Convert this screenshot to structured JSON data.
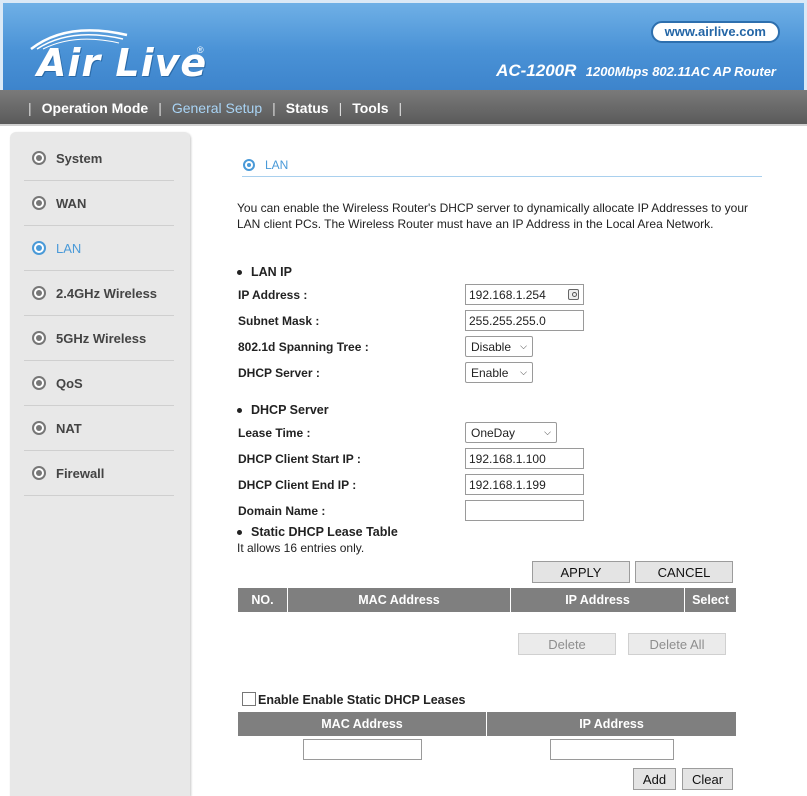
{
  "header": {
    "brand": "Air Live",
    "reg_mark": "®",
    "url": "www.airlive.com",
    "model": "AC-1200R",
    "model_desc": "1200Mbps 802.11AC AP Router"
  },
  "nav": {
    "items": [
      "Operation Mode",
      "General Setup",
      "Status",
      "Tools"
    ],
    "active": "General Setup"
  },
  "sidebar": {
    "items": [
      "System",
      "WAN",
      "LAN",
      "2.4GHz Wireless",
      "5GHz Wireless",
      "QoS",
      "NAT",
      "Firewall"
    ],
    "active": "LAN"
  },
  "main": {
    "title": "LAN",
    "description": "You can enable the Wireless Router's DHCP server to dynamically allocate IP Addresses to your LAN client PCs. The Wireless Router must have an IP Address in the Local Area Network.",
    "lan_ip": {
      "heading": "LAN IP",
      "ip_label": "IP Address :",
      "ip_value": "192.168.1.254",
      "mask_label": "Subnet Mask :",
      "mask_value": "255.255.255.0",
      "stp_label": "802.1d Spanning Tree :",
      "stp_value": "Disable",
      "dhcp_label": "DHCP Server :",
      "dhcp_value": "Enable"
    },
    "dhcp_server": {
      "heading": "DHCP Server",
      "lease_label": "Lease Time :",
      "lease_value": "OneDay",
      "start_label": "DHCP Client Start IP :",
      "start_value": "192.168.1.100",
      "end_label": "DHCP Client End IP :",
      "end_value": "192.168.1.199",
      "domain_label": "Domain Name :",
      "domain_value": ""
    },
    "static_table": {
      "heading": "Static DHCP Lease Table",
      "note": "It allows 16 entries only.",
      "apply": "APPLY",
      "cancel": "CANCEL",
      "columns": [
        "NO.",
        "MAC Address",
        "IP Address",
        "Select"
      ],
      "delete": "Delete",
      "delete_all": "Delete All"
    },
    "static_form": {
      "enable_label": "Enable Enable Static DHCP Leases",
      "enabled": false,
      "columns": [
        "MAC Address",
        "IP Address"
      ],
      "mac_value": "",
      "ip_value": "",
      "add": "Add",
      "clear": "Clear"
    }
  },
  "colors": {
    "header_blue": "#4a92d6",
    "accent": "#4a9ad8",
    "nav_gray": "#666666",
    "table_header": "#7f7f7f"
  }
}
